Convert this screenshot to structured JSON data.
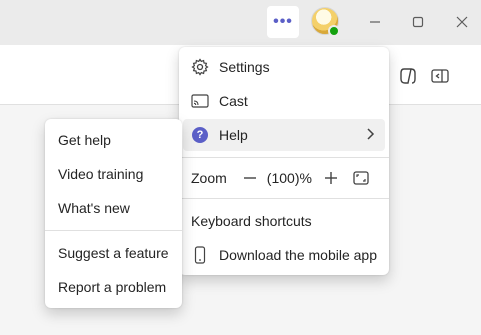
{
  "titlebar": {
    "more_label": "•••",
    "minimize_icon": "minimize-icon",
    "maximize_icon": "maximize-icon",
    "close_icon": "close-icon",
    "presence_color": "#13a10e"
  },
  "menu": {
    "items": [
      {
        "label": "Settings",
        "icon": "gear-icon"
      },
      {
        "label": "Cast",
        "icon": "cast-icon"
      },
      {
        "label": "Help",
        "icon": "help-icon"
      }
    ],
    "zoom": {
      "label": "Zoom",
      "value": "(100)%",
      "decrease_icon": "minus-icon",
      "increase_icon": "plus-icon",
      "fullscreen_icon": "fullscreen-icon"
    },
    "keyboard_shortcuts": "Keyboard shortcuts",
    "download_app": "Download the mobile app"
  },
  "help_submenu": {
    "items": [
      "Get help",
      "Video training",
      "What's new"
    ],
    "secondary_items": [
      "Suggest a feature",
      "Report a problem"
    ]
  },
  "colors": {
    "accent": "#5b5fc7",
    "titlebar_bg": "#ebebeb"
  }
}
